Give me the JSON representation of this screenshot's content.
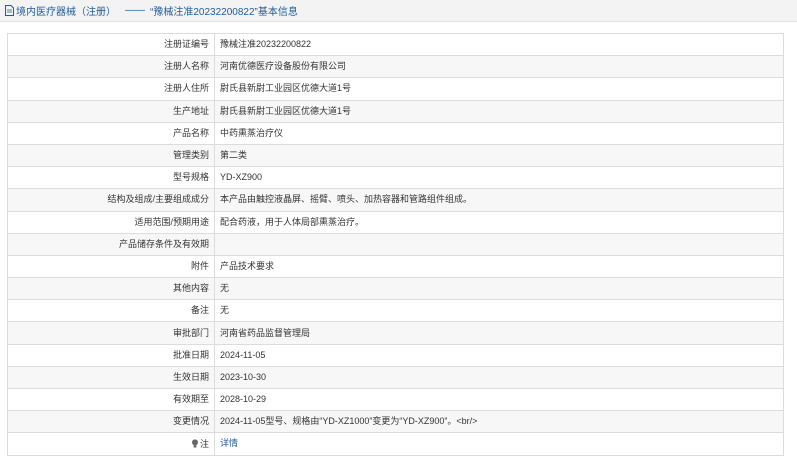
{
  "header": {
    "category": "境内医疗器械（注册）",
    "separator": "——",
    "title": "“豫械注准20232200822”基本信息"
  },
  "rows": [
    {
      "label": "注册证编号",
      "value": "豫械注准20232200822"
    },
    {
      "label": "注册人名称",
      "value": "河南优德医疗设备股份有限公司"
    },
    {
      "label": "注册人住所",
      "value": "尉氏县新尉工业园区优德大道1号"
    },
    {
      "label": "生产地址",
      "value": "尉氏县新尉工业园区优德大道1号"
    },
    {
      "label": "产品名称",
      "value": "中药熏蒸治疗仪"
    },
    {
      "label": "管理类别",
      "value": "第二类"
    },
    {
      "label": "型号规格",
      "value": "YD-XZ900"
    },
    {
      "label": "结构及组成/主要组成成分",
      "value": "本产品由触控液晶屏、摇臂、喷头、加热容器和管路组件组成。"
    },
    {
      "label": "适用范围/预期用途",
      "value": "配合药液，用于人体局部熏蒸治疗。"
    },
    {
      "label": "产品储存条件及有效期",
      "value": ""
    },
    {
      "label": "附件",
      "value": "产品技术要求"
    },
    {
      "label": "其他内容",
      "value": "无"
    },
    {
      "label": "备注",
      "value": "无"
    },
    {
      "label": "审批部门",
      "value": "河南省药品监督管理局"
    },
    {
      "label": "批准日期",
      "value": "2024-11-05"
    },
    {
      "label": "生效日期",
      "value": "2023-10-30"
    },
    {
      "label": "有效期至",
      "value": "2028-10-29"
    },
    {
      "label": "变更情况",
      "value": "2024-11-05型号、规格由“YD-XZ1000”变更为“YD-XZ900”。<br/>"
    },
    {
      "label": "注",
      "value": "详情",
      "label_icon": "lamp-icon"
    }
  ],
  "colors": {
    "link": "#1f5c99",
    "header_bg": "#f3f3f3",
    "border": "#dcdcdc"
  }
}
